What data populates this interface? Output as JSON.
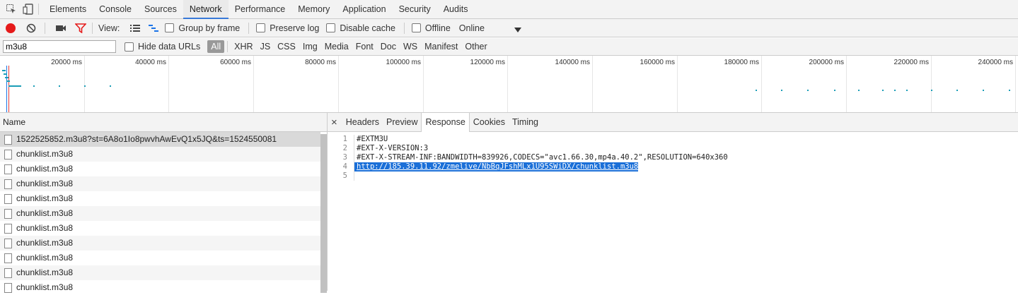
{
  "tabs": [
    "Elements",
    "Console",
    "Sources",
    "Network",
    "Performance",
    "Memory",
    "Application",
    "Security",
    "Audits"
  ],
  "active_tab": "Network",
  "toolbar": {
    "view_label": "View:",
    "group_by_frame": "Group by frame",
    "preserve_log": "Preserve log",
    "disable_cache": "Disable cache",
    "offline": "Offline",
    "throttle": "Online"
  },
  "filter": {
    "value": "m3u8",
    "hide_data_urls": "Hide data URLs",
    "types": [
      "All",
      "XHR",
      "JS",
      "CSS",
      "Img",
      "Media",
      "Font",
      "Doc",
      "WS",
      "Manifest",
      "Other"
    ]
  },
  "timeline": {
    "labels": [
      "20000 ms",
      "40000 ms",
      "60000 ms",
      "80000 ms",
      "100000 ms",
      "120000 ms",
      "140000 ms",
      "160000 ms",
      "180000 ms",
      "200000 ms",
      "220000 ms",
      "240000 ms"
    ]
  },
  "requests": {
    "header": "Name",
    "items": [
      "1522525852.m3u8?st=6A8o1Io8pwvhAwEvQ1x5JQ&ts=1524550081",
      "chunklist.m3u8",
      "chunklist.m3u8",
      "chunklist.m3u8",
      "chunklist.m3u8",
      "chunklist.m3u8",
      "chunklist.m3u8",
      "chunklist.m3u8",
      "chunklist.m3u8",
      "chunklist.m3u8",
      "chunklist.m3u8"
    ]
  },
  "detail": {
    "close": "×",
    "tabs": [
      "Headers",
      "Preview",
      "Response",
      "Cookies",
      "Timing"
    ],
    "active": "Response",
    "lines": [
      "#EXTM3U",
      "#EXT-X-VERSION:3",
      "#EXT-X-STREAM-INF:BANDWIDTH=839926,CODECS=\"avc1.66.30,mp4a.40.2\",RESOLUTION=640x360",
      "http://185.39.11.92/zmelive/NbBqJFshMLx1U95SWiDX/chunklist.m3u8",
      ""
    ]
  }
}
